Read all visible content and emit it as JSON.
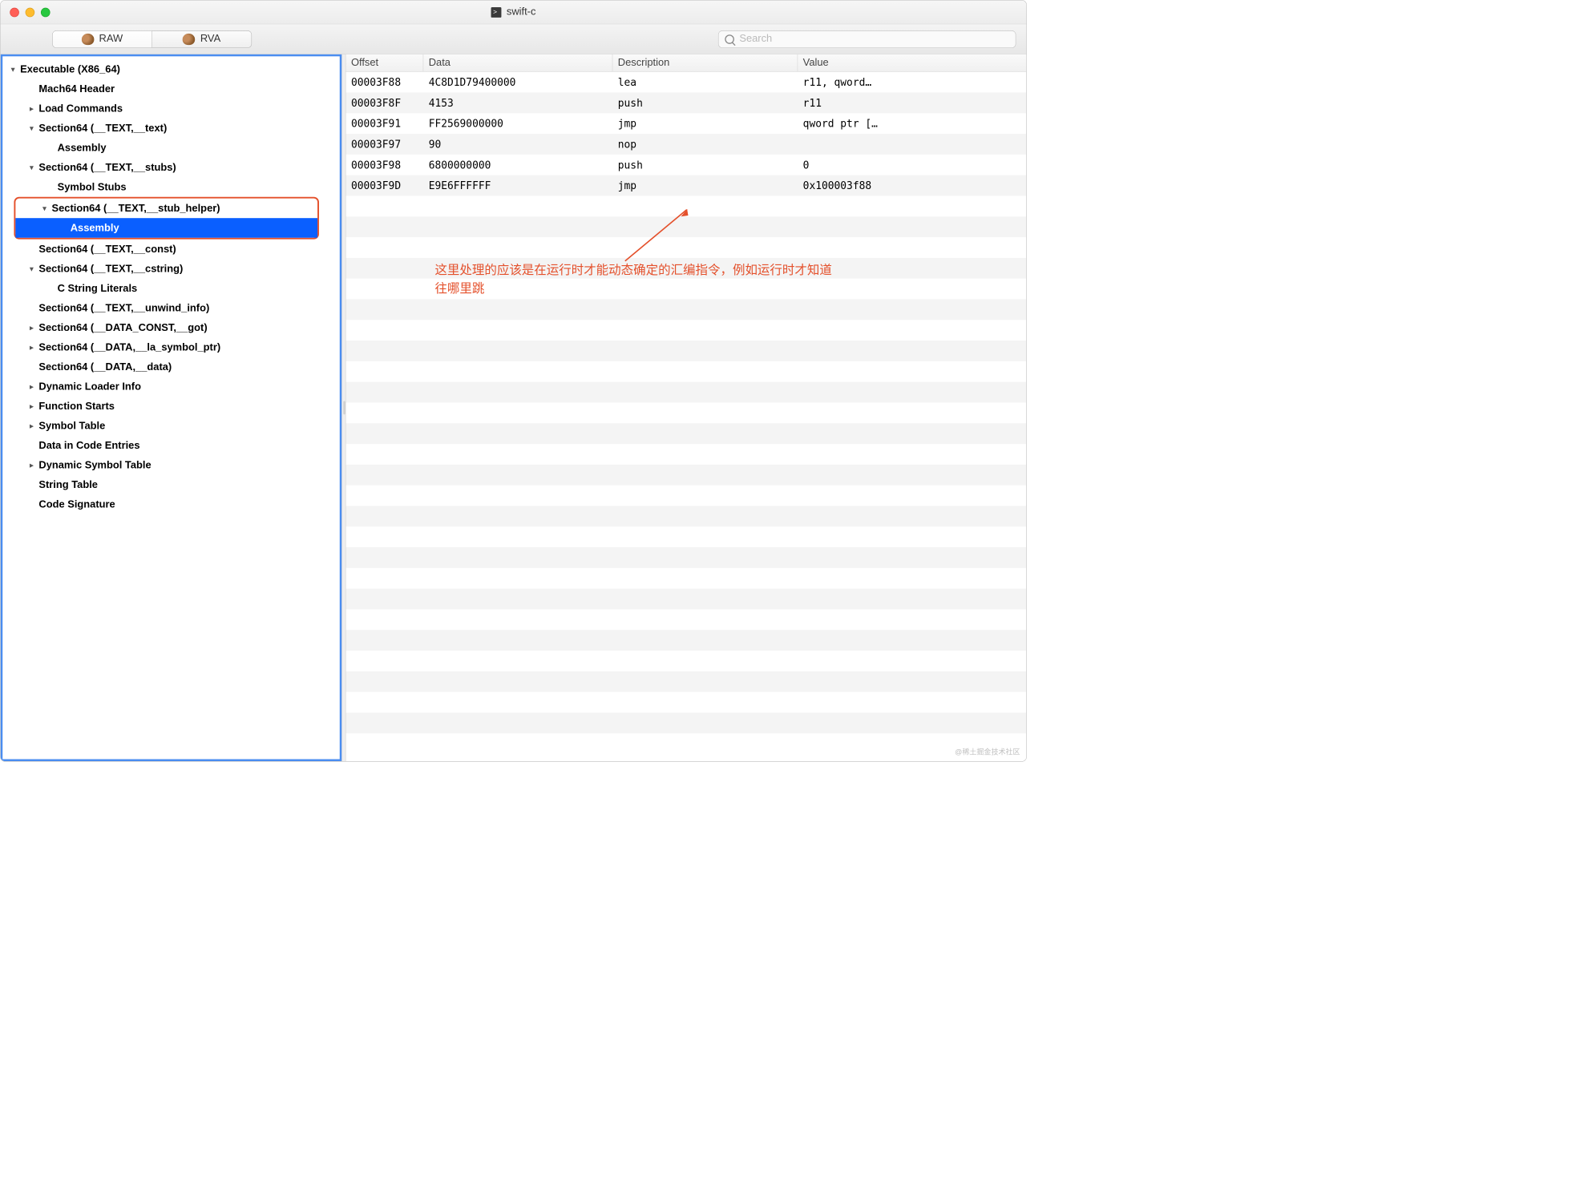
{
  "window": {
    "title": "swift-c"
  },
  "toolbar": {
    "tabs": {
      "raw": "RAW",
      "rva": "RVA",
      "active": "raw"
    },
    "search_placeholder": "Search"
  },
  "sidebar": {
    "root": "Executable  (X86_64)",
    "items": [
      {
        "label": "Mach64 Header",
        "indent": 1,
        "chev": "none"
      },
      {
        "label": "Load Commands",
        "indent": 1,
        "chev": "right"
      },
      {
        "label": "Section64 (__TEXT,__text)",
        "indent": 1,
        "chev": "down"
      },
      {
        "label": "Assembly",
        "indent": 2,
        "chev": "none"
      },
      {
        "label": "Section64 (__TEXT,__stubs)",
        "indent": 1,
        "chev": "down"
      },
      {
        "label": "Symbol Stubs",
        "indent": 2,
        "chev": "none"
      },
      {
        "label": "Section64 (__TEXT,__stub_helper)",
        "indent": 1,
        "chev": "down",
        "boxed_start": true
      },
      {
        "label": "Assembly",
        "indent": 2,
        "chev": "none",
        "selected": true,
        "boxed_end": true
      },
      {
        "label": "Section64 (__TEXT,__const)",
        "indent": 1,
        "chev": "none"
      },
      {
        "label": "Section64 (__TEXT,__cstring)",
        "indent": 1,
        "chev": "down"
      },
      {
        "label": "C String Literals",
        "indent": 2,
        "chev": "none"
      },
      {
        "label": "Section64 (__TEXT,__unwind_info)",
        "indent": 1,
        "chev": "none"
      },
      {
        "label": "Section64 (__DATA_CONST,__got)",
        "indent": 1,
        "chev": "right"
      },
      {
        "label": "Section64 (__DATA,__la_symbol_ptr)",
        "indent": 1,
        "chev": "right"
      },
      {
        "label": "Section64 (__DATA,__data)",
        "indent": 1,
        "chev": "none"
      },
      {
        "label": "Dynamic Loader Info",
        "indent": 1,
        "chev": "right"
      },
      {
        "label": "Function Starts",
        "indent": 1,
        "chev": "right"
      },
      {
        "label": "Symbol Table",
        "indent": 1,
        "chev": "right"
      },
      {
        "label": "Data in Code Entries",
        "indent": 1,
        "chev": "none"
      },
      {
        "label": "Dynamic Symbol Table",
        "indent": 1,
        "chev": "right"
      },
      {
        "label": "String Table",
        "indent": 1,
        "chev": "none"
      },
      {
        "label": "Code Signature",
        "indent": 1,
        "chev": "none"
      }
    ]
  },
  "table": {
    "headers": {
      "offset": "Offset",
      "data": "Data",
      "desc": "Description",
      "value": "Value"
    },
    "rows": [
      {
        "offset": "00003F88",
        "data": "4C8D1D79400000",
        "desc": "lea",
        "v1": "",
        "v2": "r11, qword…"
      },
      {
        "offset": "00003F8F",
        "data": "4153",
        "desc": "push",
        "v1": "",
        "v2": "r11"
      },
      {
        "offset": "00003F91",
        "data": "FF2569000000",
        "desc": "jmp",
        "v1": "",
        "v2": "qword ptr […"
      },
      {
        "offset": "00003F97",
        "data": "90",
        "desc": "nop",
        "v1": "",
        "v2": ""
      },
      {
        "offset": "00003F98",
        "data": "6800000000",
        "desc": "push",
        "v1": "",
        "v2": "0"
      },
      {
        "offset": "00003F9D",
        "data": "E9E6FFFFFF",
        "desc": "jmp",
        "v1": "",
        "v2": "0x100003f88"
      }
    ],
    "blank_rows": 26
  },
  "annotation": "这里处理的应该是在运行时才能动态确定的汇编指令，例如运行时才知道往哪里跳",
  "watermark": "@稀土掘金技术社区"
}
